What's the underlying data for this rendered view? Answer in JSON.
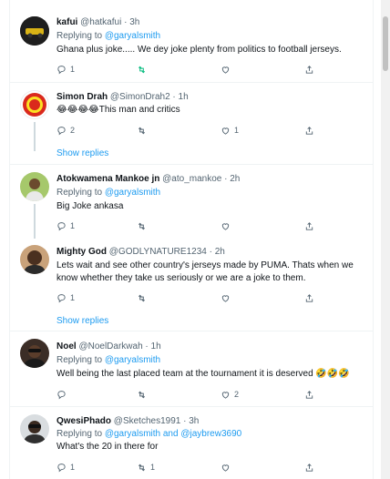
{
  "tweets": [
    {
      "name": "kafui",
      "handle": "@hatkafui",
      "time": "3h",
      "reply_prefix": "Replying to ",
      "reply_to": "@garyalsmith",
      "reply_and": "",
      "reply_to2": "",
      "text": "Ghana plus joke..... We dey joke plenty from politics to football jerseys.",
      "replies": "1",
      "retweets": "",
      "likes": "",
      "retweet_active": true
    },
    {
      "name": "Simon Drah",
      "handle": "@SimonDrah2",
      "time": "1h",
      "reply_prefix": "",
      "reply_to": "",
      "reply_and": "",
      "reply_to2": "",
      "text": "😂😂😂😂This man and critics",
      "replies": "2",
      "retweets": "",
      "likes": "1",
      "retweet_active": false,
      "show_replies": "Show replies"
    },
    {
      "name": "Atokwamena Mankoe jn",
      "handle": "@ato_mankoe",
      "time": "2h",
      "reply_prefix": "Replying to ",
      "reply_to": "@garyalsmith",
      "reply_and": "",
      "reply_to2": "",
      "text": "Big Joke ankasa",
      "replies": "1",
      "retweets": "",
      "likes": "",
      "retweet_active": false
    },
    {
      "name": "Mighty God",
      "handle": "@GODLYNATURE1234",
      "time": "2h",
      "reply_prefix": "",
      "reply_to": "",
      "reply_and": "",
      "reply_to2": "",
      "text": "Lets wait and see other country's jerseys made by PUMA. Thats when we know whether they take us seriously or we are a joke to them.",
      "replies": "1",
      "retweets": "",
      "likes": "",
      "retweet_active": false,
      "show_replies": "Show replies"
    },
    {
      "name": "Noel",
      "handle": "@NoelDarkwah",
      "time": "1h",
      "reply_prefix": "Replying to ",
      "reply_to": "@garyalsmith",
      "reply_and": "",
      "reply_to2": "",
      "text": "Well being the last placed team at the tournament it is deserved 🤣🤣🤣",
      "replies": "",
      "retweets": "",
      "likes": "2",
      "retweet_active": false
    },
    {
      "name": "QwesiPhado",
      "handle": "@Sketches1991",
      "time": "3h",
      "reply_prefix": "Replying to ",
      "reply_to": "@garyalsmith",
      "reply_and": " and ",
      "reply_to2": "@jaybrew3690",
      "text": "What's the 20 in there for",
      "replies": "1",
      "retweets": "1",
      "likes": "",
      "retweet_active": false
    }
  ],
  "colors": {
    "accent": "#1d9bf0",
    "text": "#0f1419",
    "muted": "#536471",
    "retweet": "#00ba7c"
  }
}
